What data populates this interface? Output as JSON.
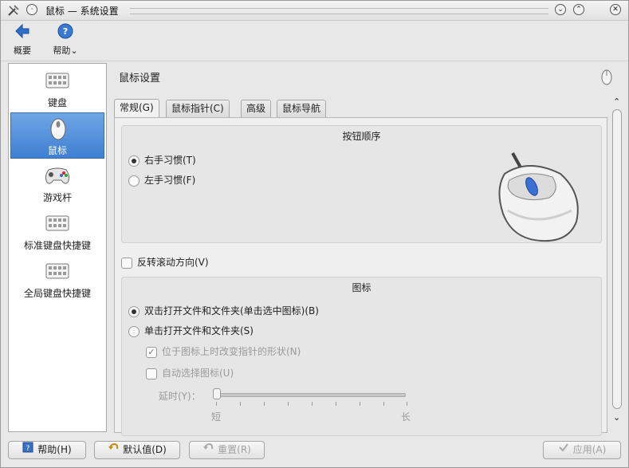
{
  "window": {
    "title": "鼠标 — 系统设置"
  },
  "toolbar": {
    "overview_label": "概要",
    "help_label": "帮助"
  },
  "sidebar": {
    "items": [
      {
        "label": "键盘",
        "icon": "keyboard-icon"
      },
      {
        "label": "鼠标",
        "icon": "mouse-icon"
      },
      {
        "label": "游戏杆",
        "icon": "gamepad-icon"
      },
      {
        "label": "标准键盘快捷键",
        "icon": "keyboard-icon"
      },
      {
        "label": "全局键盘快捷键",
        "icon": "keyboard-icon"
      }
    ],
    "active_index": 1
  },
  "main": {
    "title": "鼠标设置",
    "tabs": [
      {
        "label": "常规(G)"
      },
      {
        "label": "鼠标指针(C)"
      },
      {
        "label": "高级"
      },
      {
        "label": "鼠标导航"
      }
    ],
    "button_order": {
      "title": "按钮顺序",
      "right_handed": "右手习惯(T)",
      "left_handed": "左手习惯(F)"
    },
    "reverse_scroll": "反转滚动方向(V)",
    "icons": {
      "title": "图标",
      "double_click": "双击打开文件和文件夹(单击选中图标)(B)",
      "single_click": "单击打开文件和文件夹(S)",
      "change_pointer": "位于图标上时改变指针的形状(N)",
      "auto_select": "自动选择图标(U)",
      "delay_label": "延时(Y)：",
      "delay_short": "短",
      "delay_long": "长"
    }
  },
  "buttons": {
    "help": "帮助(H)",
    "defaults": "默认值(D)",
    "reset": "重置(R)",
    "apply": "应用(A)"
  },
  "colors": {
    "accent": "#4a86d8",
    "window_bg": "#e8e8e8"
  }
}
